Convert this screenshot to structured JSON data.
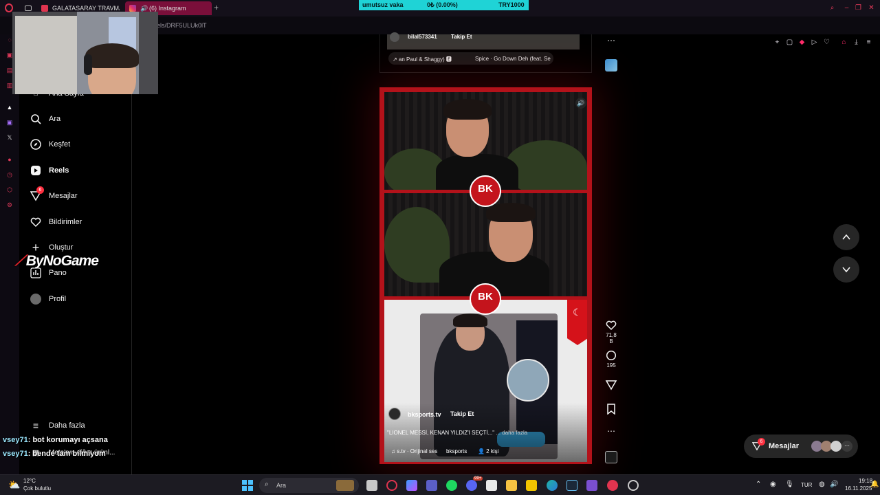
{
  "browser": {
    "tabs": [
      {
        "label": "GALATASARAY TRAVMAL"
      },
      {
        "label": "(6) Instagram"
      }
    ],
    "new_tab": "+",
    "url": "els/DRF5ULUk0lT"
  },
  "ticker": {
    "name": "umutsuz vaka",
    "change": "0₺ (0.00%)",
    "amount": "TRY1000"
  },
  "instagram_nav": [
    {
      "label": "Ana Sayfa"
    },
    {
      "label": "Ara"
    },
    {
      "label": "Keşfet"
    },
    {
      "label": "Reels"
    },
    {
      "label": "Mesajlar",
      "badge": "6"
    },
    {
      "label": "Bildirimler"
    },
    {
      "label": "Oluştur"
    },
    {
      "label": "Pano"
    },
    {
      "label": "Profil"
    },
    {
      "label": "Daha fazla"
    },
    {
      "label": "Meta'nın diğer ürünl..."
    }
  ],
  "overlay": {
    "brand": "ByNoGame",
    "chat": [
      {
        "user": "vsey71",
        "message": ": bot korumayı açsana"
      },
      {
        "user": "vsey71",
        "message": ": bende tam bilmiyom"
      }
    ]
  },
  "prev_reel": {
    "username": "bilal573341",
    "follow": "Takip Et",
    "audio_left": "↗ an Paul & Shaggy) 🅴",
    "audio_right": "Spice · Go Down Deh (feat. Sea"
  },
  "reel": {
    "logo_text": "BK",
    "username": "bksports.tv",
    "follow": "Takip Et",
    "caption": "\"LIONEL MESSİ, KENAN YILDIZ'I SEÇTİ...\"",
    "caption_more": "... daha fazla",
    "audio": "♫ s.tv · Orijinal ses",
    "audio_tag": "bksports",
    "people": "👤 2 kişi"
  },
  "actions": {
    "likes": "71,8 B",
    "comments": "195"
  },
  "messages_pill": {
    "label": "Mesajlar",
    "badge": "6"
  },
  "taskbar": {
    "weather_temp": "12°C",
    "weather_desc": "Çok bulutlu",
    "search_placeholder": "Ara",
    "lang": "TUR",
    "time": "19:18",
    "date": "16.11.2025",
    "store_badge": "99+"
  }
}
